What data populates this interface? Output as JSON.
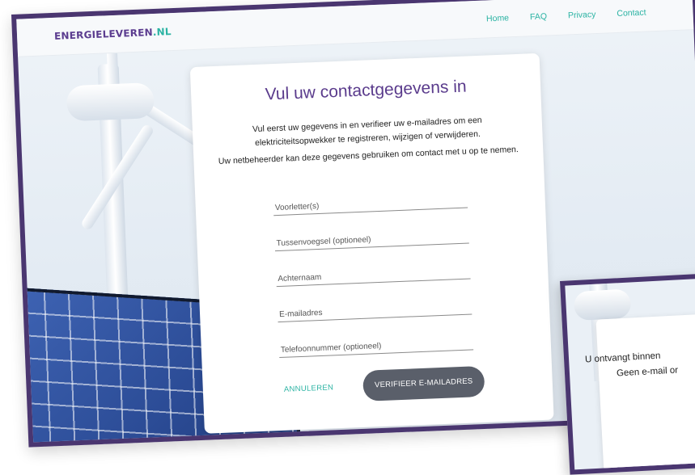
{
  "header": {
    "logo_main": "ENERGIELEVEREN",
    "logo_tld": ".NL",
    "nav": [
      "Home",
      "FAQ",
      "Privacy",
      "Contact"
    ]
  },
  "form": {
    "title": "Vul uw contactgegevens in",
    "intro_line1": "Vul eerst uw gegevens in en verifieer uw e-mailadres om een elektriciteitsopwekker te registreren, wijzigen of verwijderen.",
    "intro_line2": "Uw netbeheerder kan deze gegevens gebruiken om contact met u op te nemen.",
    "fields": [
      {
        "label": "Voorletter(s)",
        "value": ""
      },
      {
        "label": "Tussenvoegsel (optioneel)",
        "value": ""
      },
      {
        "label": "Achternaam",
        "value": ""
      },
      {
        "label": "E-mailadres",
        "value": ""
      },
      {
        "label": "Telefoonnummer (optioneel)",
        "value": ""
      }
    ],
    "cancel_label": "ANNULEREN",
    "verify_label": "VERIFIEER E-MAILADRES"
  },
  "second_screen": {
    "line1": "U ontvangt binnen",
    "line2": "Geen e-mail or"
  },
  "colors": {
    "brand_purple": "#5b3c8f",
    "accent_teal": "#2bb3a3",
    "frame": "#4a3670",
    "button_gray": "#5a5f6a"
  }
}
